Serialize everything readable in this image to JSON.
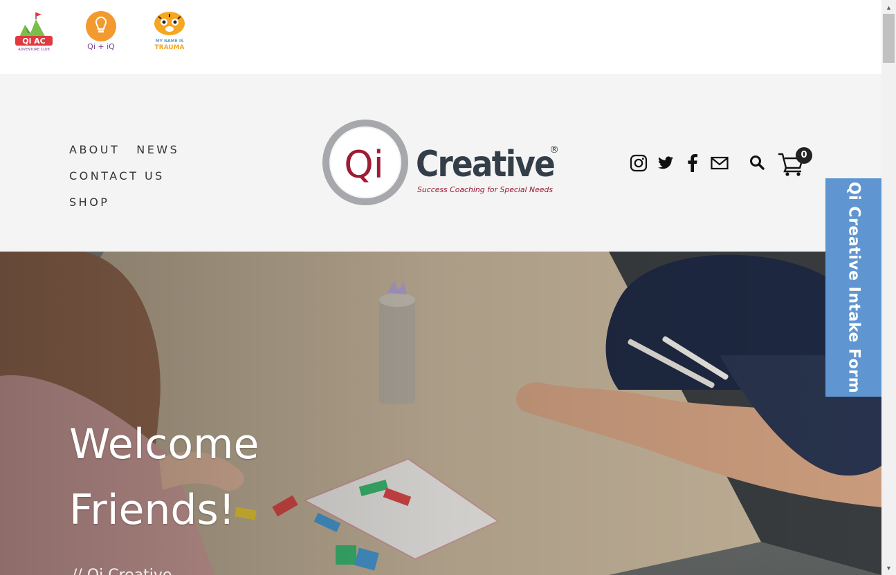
{
  "brands": [
    {
      "name": "Qi AC Adventure Club",
      "text_top": "Qi AC",
      "text_bottom": "ADVENTURE CLUB",
      "color": "#e03a3e"
    },
    {
      "name": "Qi + iQ",
      "text": "Qi + iQ",
      "color": "#f29a2e"
    },
    {
      "name": "My Name Is Trauma",
      "text_top": "MY NAME IS",
      "text_bottom": "TRAUMA",
      "color": "#f5a623"
    }
  ],
  "nav": {
    "items": [
      {
        "label": "ABOUT"
      },
      {
        "label": "NEWS"
      },
      {
        "label": "CONTACT US"
      },
      {
        "label": "SHOP"
      }
    ]
  },
  "logo": {
    "mark": "Qi",
    "wordmark": "Creative",
    "registered": "®",
    "tagline": "Success Coaching for Special Needs",
    "ring_color": "#a6a8ab",
    "mark_color": "#9d1b33",
    "wordmark_color": "#333e48"
  },
  "social": [
    {
      "icon": "instagram-icon"
    },
    {
      "icon": "twitter-icon"
    },
    {
      "icon": "facebook-icon"
    },
    {
      "icon": "email-icon"
    }
  ],
  "cart": {
    "count": "0"
  },
  "hero": {
    "title_line1": "Welcome",
    "title_line2": "Friends!",
    "subtitle": "// Qi Creative"
  },
  "intake_tab": {
    "label": "Qi Creative Intake Form",
    "color": "#5f96d1"
  },
  "scrollbar": {
    "up": "▲",
    "down": "▼"
  }
}
